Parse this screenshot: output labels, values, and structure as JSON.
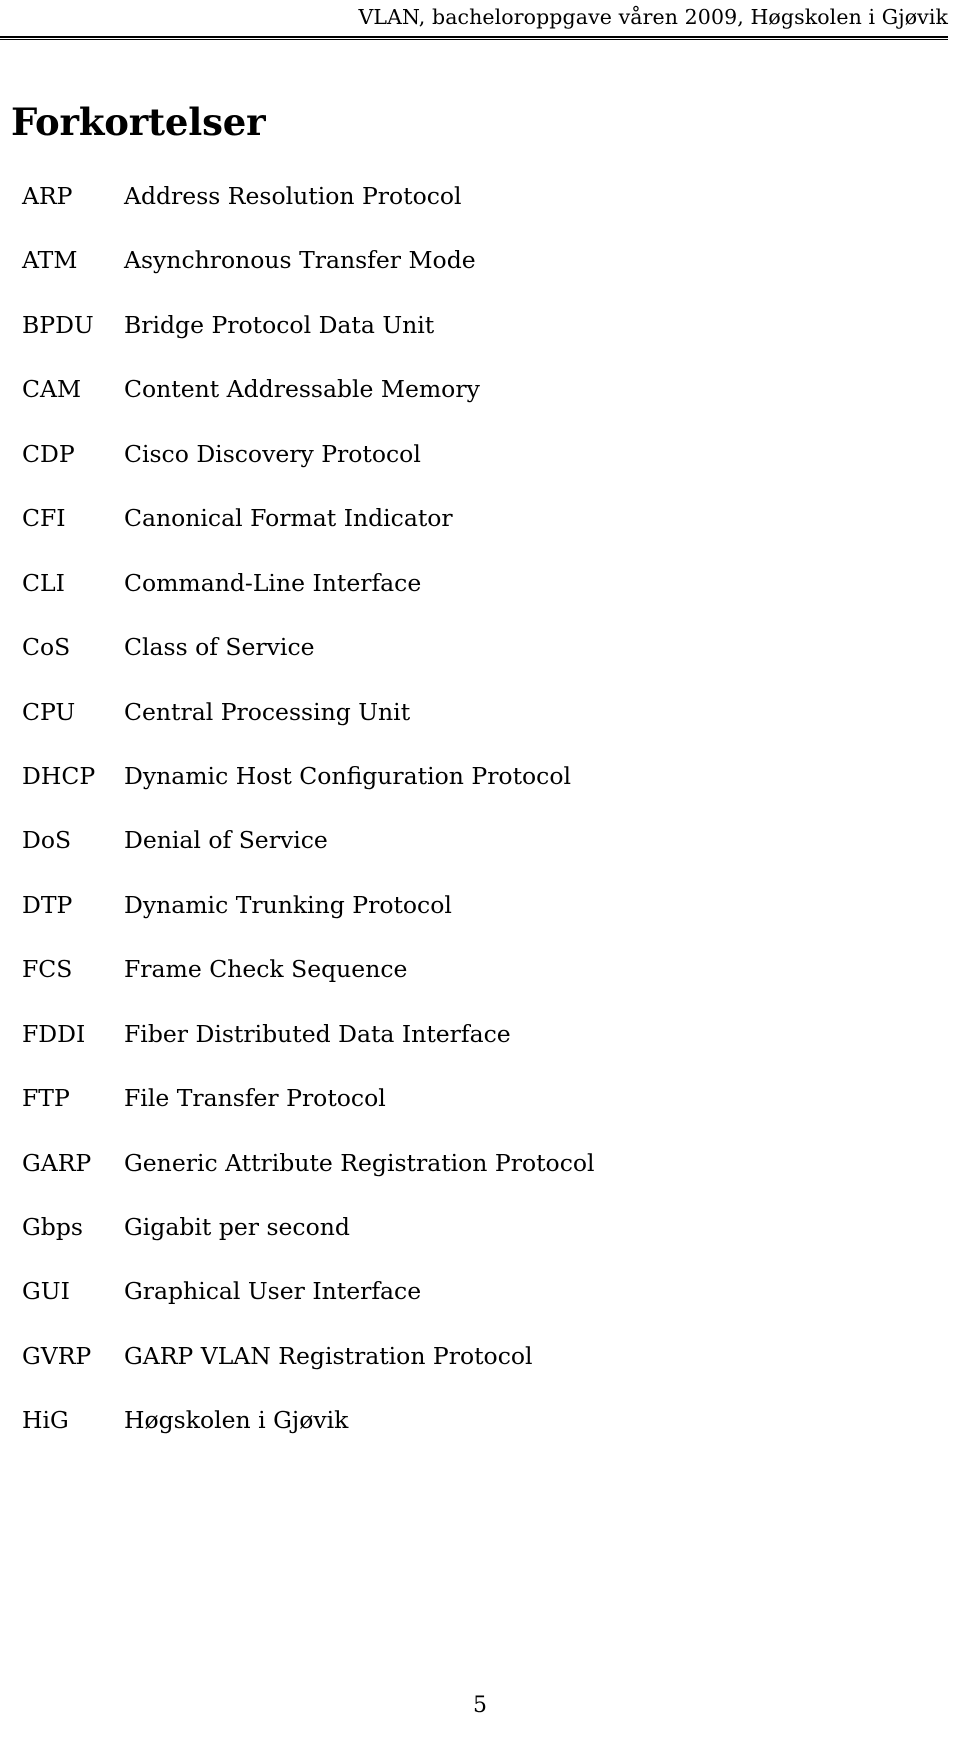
{
  "header": {
    "running_title": "VLAN, bacheloroppgave våren 2009, Høgskolen i Gjøvik"
  },
  "section": {
    "title": "Forkortelser"
  },
  "abbreviations": [
    {
      "term": "ARP",
      "definition": "Address Resolution Protocol"
    },
    {
      "term": "ATM",
      "definition": "Asynchronous Transfer Mode"
    },
    {
      "term": "BPDU",
      "definition": "Bridge Protocol Data Unit"
    },
    {
      "term": "CAM",
      "definition": "Content Addressable Memory"
    },
    {
      "term": "CDP",
      "definition": "Cisco Discovery Protocol"
    },
    {
      "term": "CFI",
      "definition": "Canonical Format Indicator"
    },
    {
      "term": "CLI",
      "definition": "Command-Line Interface"
    },
    {
      "term": "CoS",
      "definition": "Class of Service"
    },
    {
      "term": "CPU",
      "definition": "Central Processing Unit"
    },
    {
      "term": "DHCP",
      "definition": "Dynamic Host Configuration Protocol"
    },
    {
      "term": "DoS",
      "definition": "Denial of Service"
    },
    {
      "term": "DTP",
      "definition": "Dynamic Trunking Protocol"
    },
    {
      "term": "FCS",
      "definition": "Frame Check Sequence"
    },
    {
      "term": "FDDI",
      "definition": "Fiber Distributed Data Interface"
    },
    {
      "term": "FTP",
      "definition": "File Transfer Protocol"
    },
    {
      "term": "GARP",
      "definition": "Generic Attribute Registration Protocol"
    },
    {
      "term": "Gbps",
      "definition": "Gigabit per second"
    },
    {
      "term": "GUI",
      "definition": "Graphical User Interface"
    },
    {
      "term": "GVRP",
      "definition": "GARP VLAN Registration Protocol"
    },
    {
      "term": "HiG",
      "definition": "Høgskolen i Gjøvik"
    }
  ],
  "footer": {
    "page_number": "5"
  }
}
